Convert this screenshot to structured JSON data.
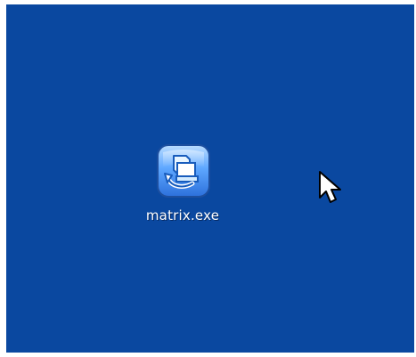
{
  "desktop": {
    "background_color": "#0a48a0",
    "icons": [
      {
        "label": "matrix.exe",
        "icon": "application-icon",
        "selected": false
      }
    ]
  },
  "pointer": {
    "icon": "mouse-pointer-icon"
  }
}
